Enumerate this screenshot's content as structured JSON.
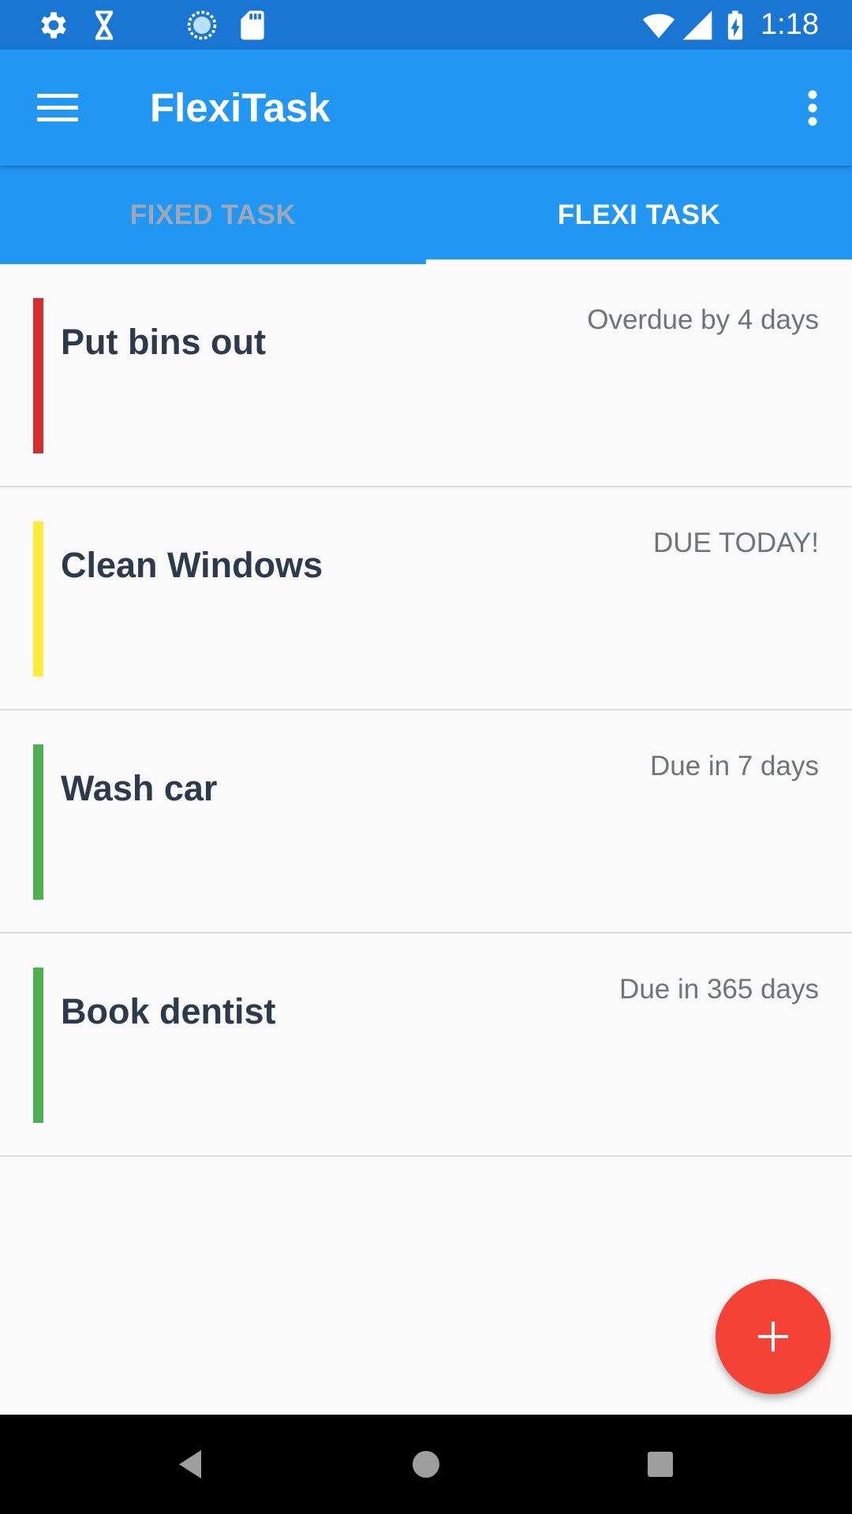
{
  "status_bar": {
    "time": "1:18",
    "left_icons": [
      "settings-icon",
      "hourglass-icon",
      "sync-icon",
      "sd-card-icon"
    ],
    "right_icons": [
      "wifi-icon",
      "signal-icon",
      "battery-charging-icon"
    ]
  },
  "app_bar": {
    "title": "FlexiTask",
    "menu_icon": "hamburger-menu-icon",
    "overflow_icon": "more-vert-icon"
  },
  "tabs": [
    {
      "label": "FIXED TASK",
      "selected": false
    },
    {
      "label": "FLEXI TASK",
      "selected": true
    }
  ],
  "tasks": [
    {
      "name": "Put bins out",
      "due": "Overdue by 4 days",
      "status_color": "#d32f2f"
    },
    {
      "name": "Clean Windows",
      "due": "DUE TODAY!",
      "status_color": "#ffeb3b"
    },
    {
      "name": "Wash car",
      "due": "Due in 7 days",
      "status_color": "#4caf50"
    },
    {
      "name": "Book dentist",
      "due": "Due in 365 days",
      "status_color": "#4caf50"
    }
  ],
  "fab": {
    "icon": "add-icon",
    "color": "#f44336"
  },
  "nav_bar": {
    "buttons": [
      "back-icon",
      "home-icon",
      "recents-icon"
    ]
  },
  "colors": {
    "status_bar": "#1976d2",
    "primary": "#2196f3",
    "tab_inactive_text": "#9fa8b4",
    "task_title": "#2c3a4b",
    "due_text": "#6f7479"
  }
}
